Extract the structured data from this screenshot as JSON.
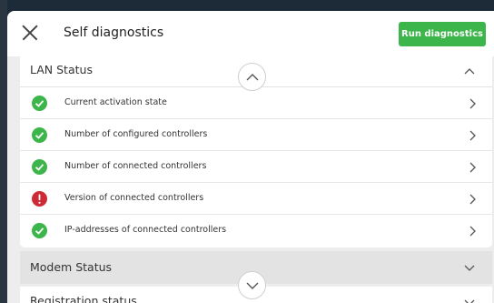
{
  "header": {
    "title": "Self diagnostics",
    "run_button": "Run diagnostics",
    "run_button_color": "#3cb54a"
  },
  "lan": {
    "title": "LAN Status",
    "items": [
      {
        "label": "Current activation state",
        "status": "ok"
      },
      {
        "label": "Number of configured controllers",
        "status": "ok"
      },
      {
        "label": "Number of connected controllers",
        "status": "ok"
      },
      {
        "label": "Version of connected controllers",
        "status": "error"
      },
      {
        "label": "IP-addresses of connected controllers",
        "status": "ok"
      }
    ]
  },
  "modem": {
    "title": "Modem Status"
  },
  "registration": {
    "title": "Registration status"
  },
  "colors": {
    "ok": "#3cb54a",
    "error": "#cc2a37"
  }
}
